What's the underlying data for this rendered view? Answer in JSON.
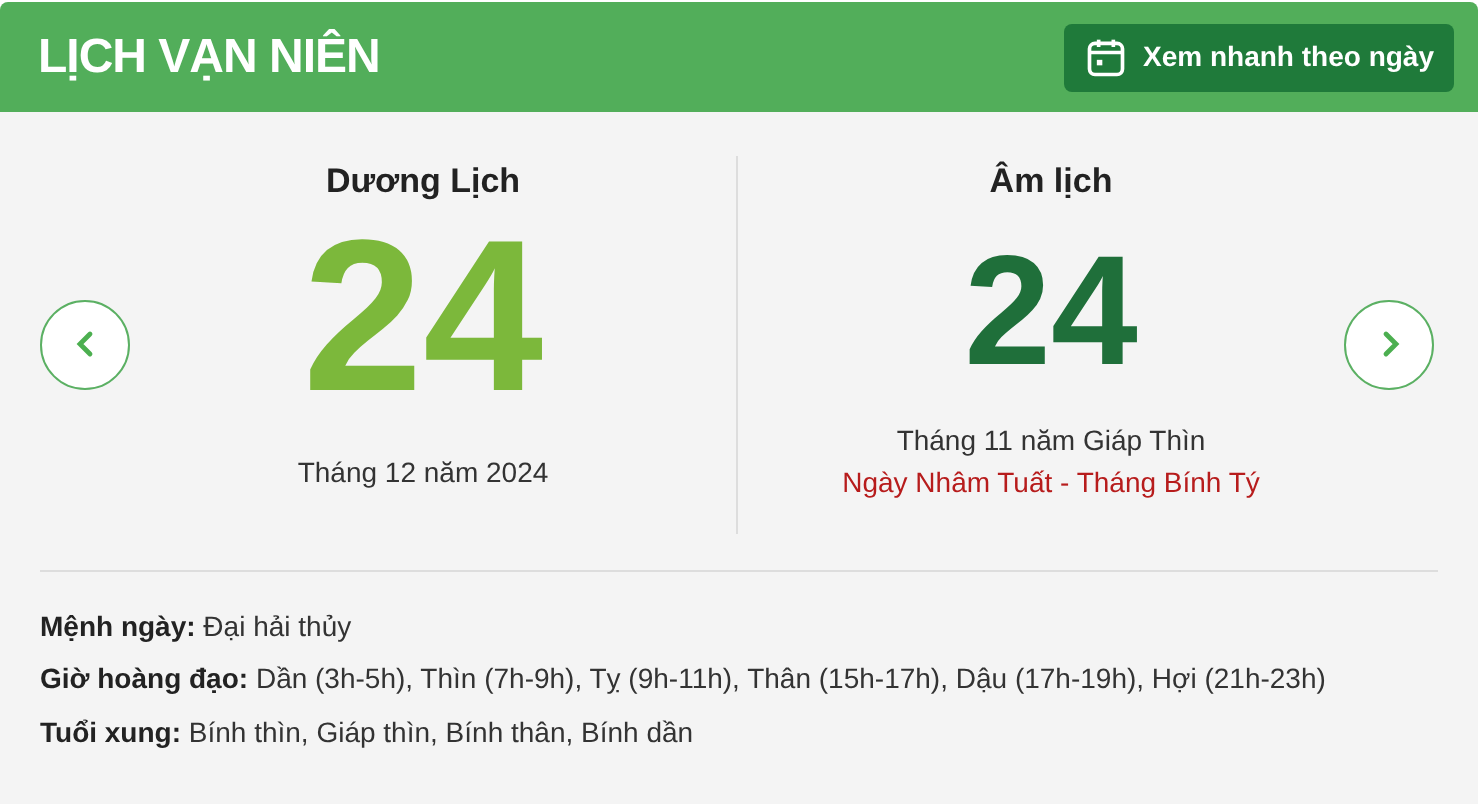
{
  "header": {
    "title": "LỊCH VẠN NIÊN",
    "button": "Xem nhanh theo ngày"
  },
  "solar": {
    "heading": "Dương Lịch",
    "day": "24",
    "subtitle": "Tháng 12 năm 2024"
  },
  "lunar": {
    "heading": "Âm lịch",
    "day": "24",
    "subtitle": "Tháng 11 năm Giáp Thìn",
    "detail": "Ngày Nhâm Tuất - Tháng Bính Tý"
  },
  "details": [
    {
      "text": "**Mệnh ngày:** Đại hải thủy"
    },
    {
      "text": "**Giờ hoàng đạo:** Dần (3h-5h), Thìn (7h-9h), Tỵ (9h-11h), Thân (15h-17h), Dậu (17h-19h), Hợi (21h-23h)"
    },
    {
      "text": "**Tuổi xung:** Bính thìn, Giáp thìn, Bính thân, Bính dần"
    }
  ]
}
